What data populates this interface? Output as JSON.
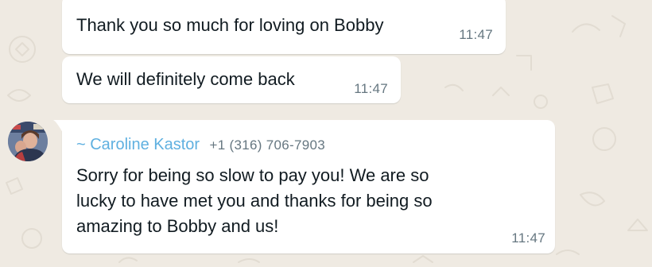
{
  "messages": [
    {
      "text": "Thank you so much for loving on Bobby",
      "time": "11:47"
    },
    {
      "text": "We will definitely come back",
      "time": "11:47"
    },
    {
      "sender_name": "~ Caroline Kastor",
      "sender_phone": "+1 (316) 706-7903",
      "lines": [
        "Sorry for being so slow to pay you! We are so",
        "lucky to have met you and thanks for being so",
        "amazing to Bobby and us!"
      ],
      "time": "11:47"
    }
  ],
  "colors": {
    "chat_background": "#efeae2",
    "bubble": "#ffffff",
    "sender_name": "#5fb0e0",
    "timestamp": "#667781"
  },
  "icons": {
    "avatar": "contact-avatar"
  }
}
